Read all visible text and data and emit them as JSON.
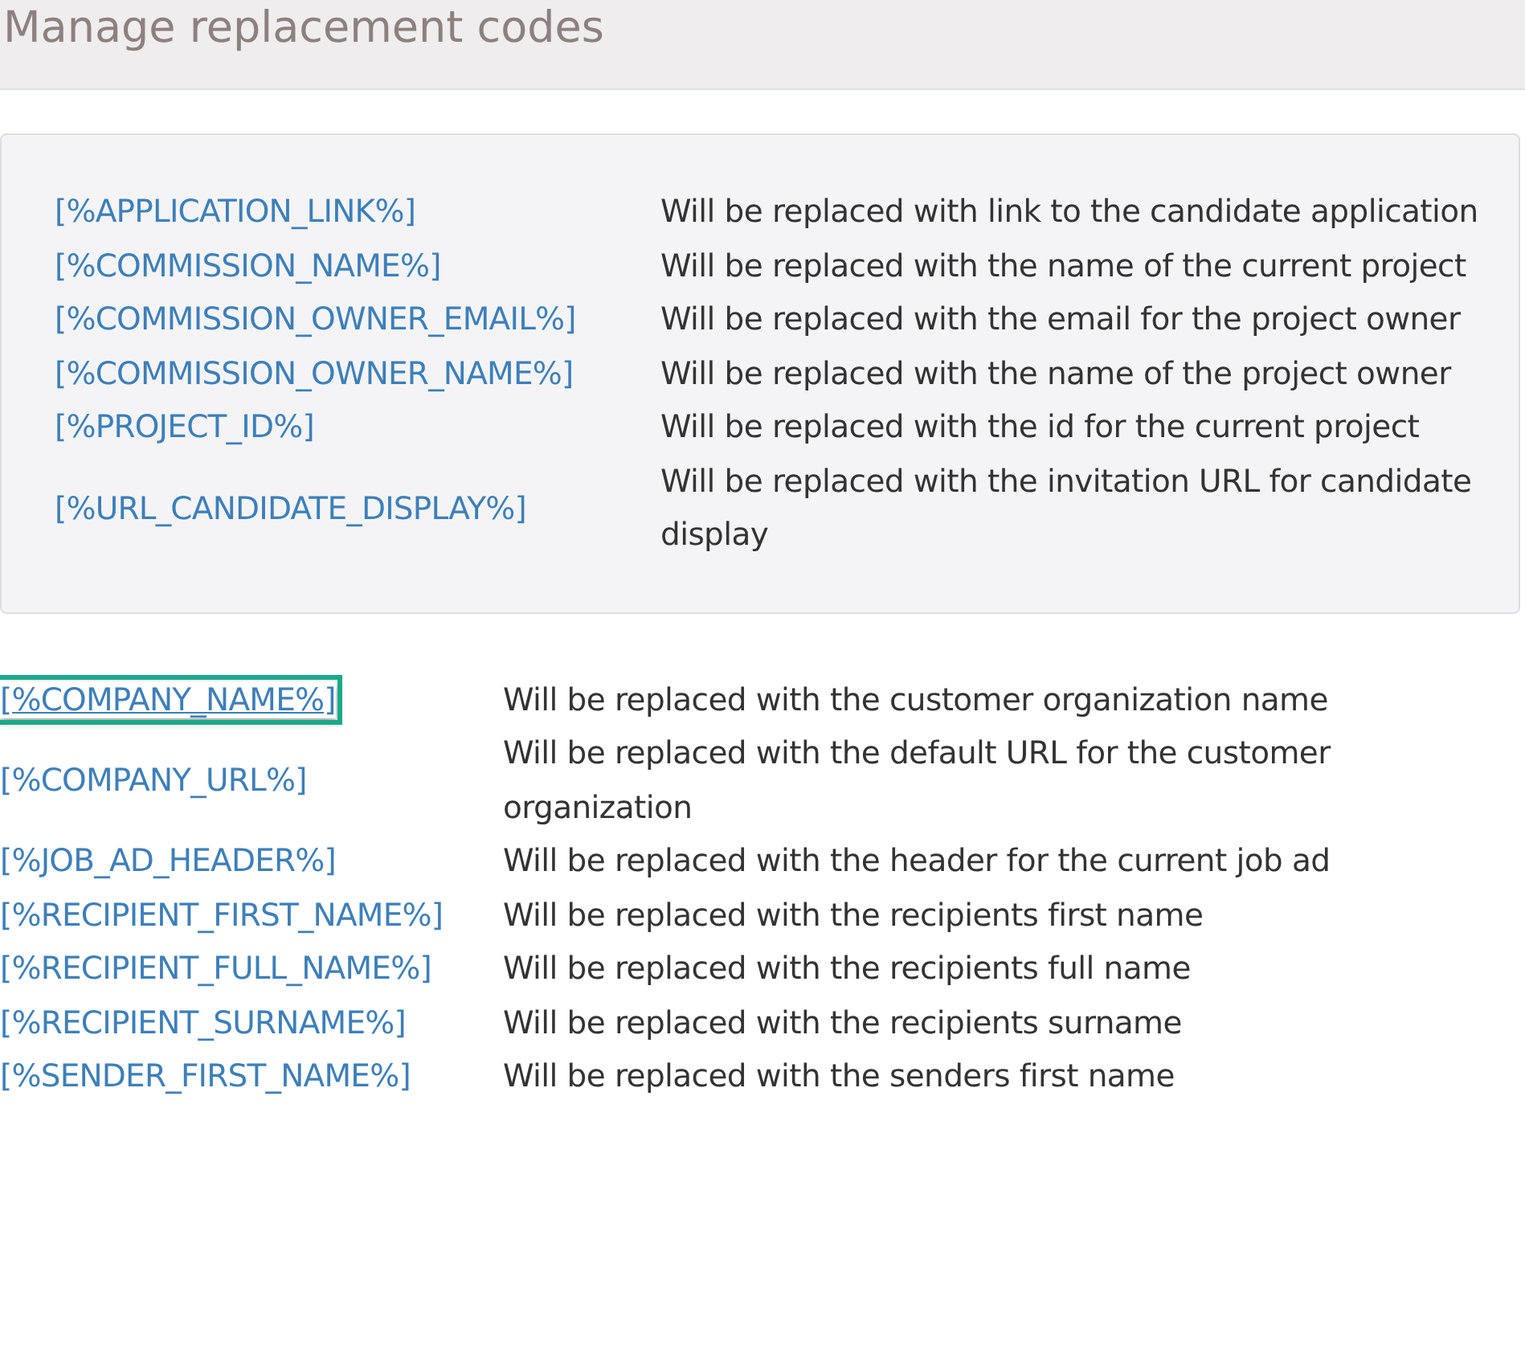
{
  "header": {
    "title": "Manage replacement codes"
  },
  "panel_codes": [
    {
      "code": "[%APPLICATION_LINK%]",
      "description": "Will be replaced with link to the candidate application"
    },
    {
      "code": "[%COMMISSION_NAME%]",
      "description": "Will be replaced with the name of the current project"
    },
    {
      "code": "[%COMMISSION_OWNER_EMAIL%]",
      "description": "Will be replaced with the email for the project owner"
    },
    {
      "code": "[%COMMISSION_OWNER_NAME%]",
      "description": "Will be replaced with the name of the project owner"
    },
    {
      "code": "[%PROJECT_ID%]",
      "description": "Will be replaced with the id for the current project"
    },
    {
      "code": "[%URL_CANDIDATE_DISPLAY%]",
      "description": "Will be replaced with the invitation URL for candidate display"
    }
  ],
  "codes": [
    {
      "code": "[%COMPANY_NAME%]",
      "description": "Will be replaced with the customer organization name",
      "selected": true
    },
    {
      "code": "[%COMPANY_URL%]",
      "description": "Will be replaced with the default URL for the customer organization",
      "selected": false
    },
    {
      "code": "[%JOB_AD_HEADER%]",
      "description": "Will be replaced with the header for the current job ad",
      "selected": false
    },
    {
      "code": "[%RECIPIENT_FIRST_NAME%]",
      "description": "Will be replaced with the recipients first name",
      "selected": false
    },
    {
      "code": "[%RECIPIENT_FULL_NAME%]",
      "description": "Will be replaced with the recipients full name",
      "selected": false
    },
    {
      "code": "[%RECIPIENT_SURNAME%]",
      "description": "Will be replaced with the recipients surname",
      "selected": false
    },
    {
      "code": "[%SENDER_FIRST_NAME%]",
      "description": "Will be replaced with the senders first name",
      "selected": false
    }
  ]
}
